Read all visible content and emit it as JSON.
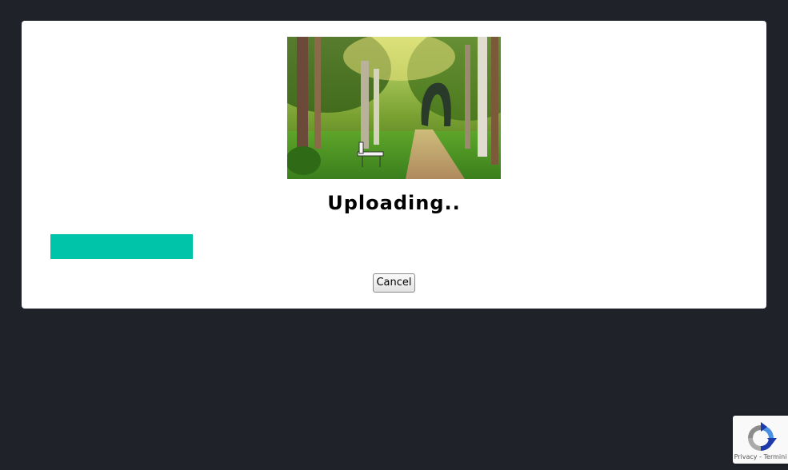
{
  "upload_dialog": {
    "title": "Uploading..",
    "progress": 0.207,
    "progress_color": "#00c4aa",
    "cancel_label": "Cancel"
  },
  "recaptcha": {
    "privacy_label": "Privacy",
    "separator": "-",
    "terms_label": "Termini"
  },
  "colors": {
    "page_background": "#1f2229",
    "card_background": "#ffffff"
  }
}
